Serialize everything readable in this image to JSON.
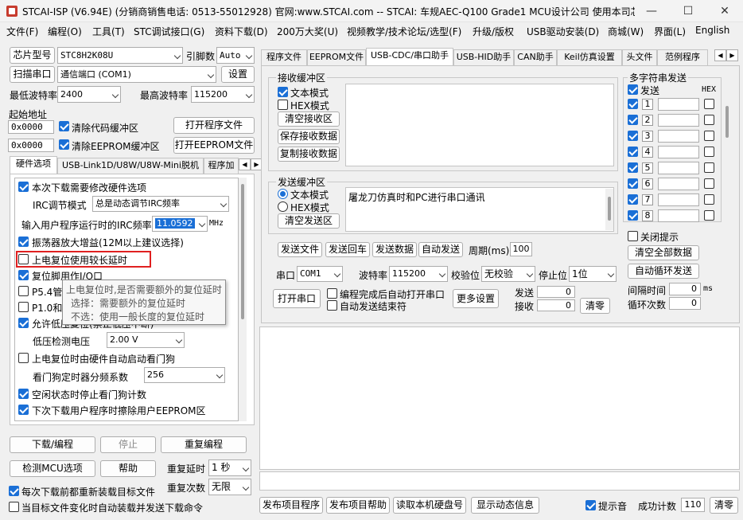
{
  "window": {
    "title": "STCAI-ISP (V6.94E) (分销商销售电话: 0513-55012928) 官网:www.STCAI.com  -- STCAI: 车规AEC-Q100 Grade1 MCU设计公司 使用本司芯片或采…",
    "minimize_icon": "minimize-icon",
    "maximize_icon": "maximize-icon",
    "close_icon": "close-icon"
  },
  "menu": [
    "文件(F)",
    "编程(O)",
    "工具(T)",
    "STC调试接口(G)",
    "资料下载(D)",
    "200万大奖(U)",
    "视频教学/技术论坛/选型(F)",
    "升级/版权",
    "USB驱动安装(D)",
    "商城(W)",
    "界面(L)",
    "English"
  ],
  "left": {
    "chip_model_button": "芯片型号",
    "chip_model_value": "STC8H2K08U",
    "pin_count_label": "引脚数",
    "pin_count_value": "Auto",
    "scan_port_button": "扫描串口",
    "port_value": "通信端口 (COM1)",
    "settings_button": "设置",
    "min_baud_label": "最低波特率",
    "min_baud_value": "2400",
    "max_baud_label": "最高波特率",
    "max_baud_value": "115200",
    "start_addr_label": "起始地址",
    "addr1_value": "0x0000",
    "clear_code_buffer": "清除代码缓冲区",
    "open_program_file": "打开程序文件",
    "addr2_value": "0x0000",
    "clear_eeprom_buffer": "清除EEPROM缓冲区",
    "open_eeprom_file": "打开EEPROM文件",
    "tabs": [
      "硬件选项",
      "USB-Link1D/U8W/U8W-Mini脱机",
      "程序加"
    ],
    "hw": {
      "modify_hw": "本次下载需要修改硬件选项",
      "irc_mode_label": "IRC调节模式",
      "irc_mode_value": "总是动态调节IRC频率",
      "irc_freq_label": "输入用户程序运行时的IRC频率",
      "irc_freq_value": "11.0592",
      "irc_freq_unit": "MHz",
      "osc_gain": "振荡器放大增益(12M以上建议选择)",
      "long_delay": "上电复位使用较长延时",
      "reset_io": "复位脚用作I/O口",
      "p54_prefix": "P5.4管",
      "p10_prefix": "P1.0和",
      "allow_lvr_prefix": "允许低",
      "allow_lvr_hidden": "压复位(禁止低压中断)",
      "lvd_label": "低压检测电压",
      "lvd_value": "2.00 V",
      "wdt_on_reset": "上电复位时由硬件自动启动看门狗",
      "wdt_div_label": "看门狗定时器分频系数",
      "wdt_div_value": "256",
      "wdt_idle_stop": "空闲状态时停止看门狗计数",
      "erase_eeprom": "下次下载用户程序时擦除用户EEPROM区"
    },
    "tooltip": {
      "line1": "上电复位时,是否需要额外的复位延时",
      "line2": "选择：需要额外的复位延时",
      "line3": "不选：使用一般长度的复位延时"
    },
    "download_button": "下载/编程",
    "stop_button": "停止",
    "reprogram_button": "重复编程",
    "check_mcu_button": "检测MCU选项",
    "help_button": "帮助",
    "repeat_delay_label": "重复延时",
    "repeat_delay_value": "1 秒",
    "repeat_count_label": "重复次数",
    "repeat_count_value": "无限",
    "reload_each_time": "每次下载前都重新装载目标文件",
    "auto_load_send": "当目标文件变化时自动装载并发送下载命令"
  },
  "right": {
    "tabs": [
      "程序文件",
      "EEPROM文件",
      "USB-CDC/串口助手",
      "USB-HID助手",
      "CAN助手",
      "Keil仿真设置",
      "头文件",
      "范例程序"
    ],
    "recv": {
      "title": "接收缓冲区",
      "text_mode": "文本模式",
      "hex_mode": "HEX模式",
      "clear_button": "清空接收区",
      "save_button": "保存接收数据",
      "copy_button": "复制接收数据"
    },
    "send": {
      "title": "发送缓冲区",
      "text_mode": "文本模式",
      "hex_mode": "HEX模式",
      "clear_button": "清空发送区",
      "content": "屠龙刀仿真时和PC进行串口通讯"
    },
    "multi": {
      "title": "多字符串发送",
      "send_label": "发送",
      "hex_label": "HEX",
      "rows": [
        "1",
        "2",
        "3",
        "4",
        "5",
        "6",
        "7",
        "8"
      ],
      "close_tip": "关闭提示",
      "clear_all": "清空全部数据",
      "auto_loop": "自动循环发送",
      "interval_label": "间隔时间",
      "interval_value": "0",
      "interval_unit": "ms",
      "loop_count_label": "循环次数",
      "loop_count_value": "0"
    },
    "actions": {
      "send_file": "发送文件",
      "send_back": "发送回车",
      "send_data": "发送数据",
      "auto_send": "自动发送",
      "period_label": "周期(ms)",
      "period_value": "100"
    },
    "port": {
      "port_label": "串口",
      "port_value": "COM1",
      "baud_label": "波特率",
      "baud_value": "115200",
      "parity_label": "校验位",
      "parity_value": "无校验",
      "stop_label": "停止位",
      "stop_value": "1位",
      "open_button": "打开串口",
      "auto_open": "编程完成后自动打开串口",
      "auto_close": "自动发送结束符",
      "more_settings": "更多设置",
      "sent_label": "发送",
      "sent_value": "0",
      "recv_label": "接收",
      "recv_value": "0",
      "clear_button": "清零"
    }
  },
  "bottom": {
    "publish_program": "发布项目程序",
    "publish_help": "发布项目帮助",
    "read_disk_id": "读取本机硬盘号",
    "show_dynamic": "显示动态信息",
    "sound_tip": "提示音",
    "success_label": "成功计数",
    "success_value": "110",
    "clear_button": "清零"
  }
}
